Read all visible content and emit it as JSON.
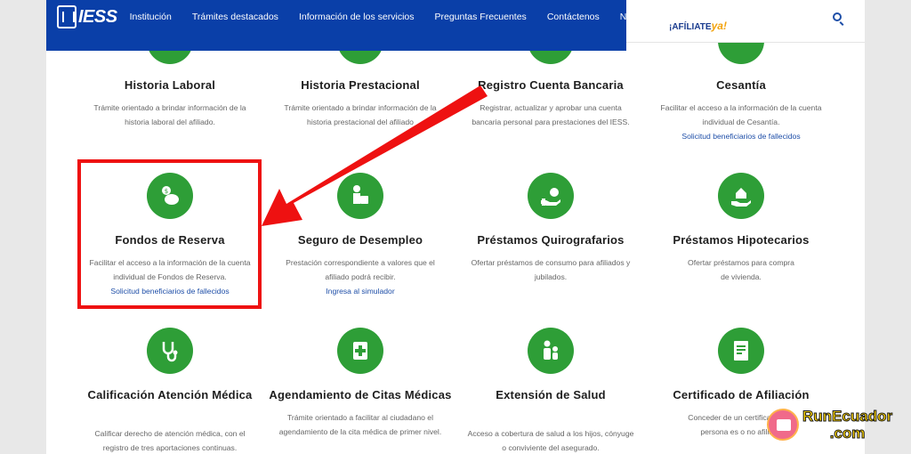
{
  "nav": {
    "logo": "IESS",
    "items": [
      "Institución",
      "Trámites destacados",
      "Información de los servicios",
      "Preguntas Frecuentes",
      "Contáctenos",
      "Noticias"
    ]
  },
  "header_right": {
    "afiliate_main": "¡AFÍLIATE",
    "afiliate_ya": "ya!"
  },
  "cards": [
    {
      "title": "Historia Laboral",
      "desc": [
        "Trámite orientado a brindar información de la",
        "historia laboral del afiliado."
      ],
      "link": ""
    },
    {
      "title": "Historia Prestacional",
      "desc": [
        "Trámite orientado a brindar información de la",
        "historia prestacional del afiliado"
      ],
      "link": ""
    },
    {
      "title": "Registro Cuenta Bancaria",
      "desc": [
        "Registrar, actualizar y aprobar una cuenta",
        "bancaria personal para prestaciones del IESS."
      ],
      "link": ""
    },
    {
      "title": "Cesantía",
      "desc": [
        "Facilitar el acceso a la información de la cuenta",
        "individual de Cesantía."
      ],
      "link": "Solicitud beneficiarios de fallecidos"
    },
    {
      "title": "Fondos de Reserva",
      "desc": [
        "Facilitar el acceso a la información de la cuenta",
        "individual de Fondos de Reserva."
      ],
      "link": "Solicitud beneficiarios de fallecidos"
    },
    {
      "title": "Seguro de Desempleo",
      "desc": [
        "Prestación correspondiente a valores que el",
        "afiliado podrá recibir."
      ],
      "link": "Ingresa al simulador"
    },
    {
      "title": "Préstamos Quirografarios",
      "desc": [
        "Ofertar préstamos de consumo para afiliados y",
        "jubilados."
      ],
      "link": ""
    },
    {
      "title": "Préstamos Hipotecarios",
      "desc": [
        "",
        "Ofertar préstamos para compra",
        "de vivienda."
      ],
      "link": ""
    },
    {
      "title": "Calificación Atención Médica",
      "desc": [
        "Calificar derecho de atención médica, con el",
        "registro de tres aportaciones continuas."
      ],
      "link": ""
    },
    {
      "title": "Agendamiento de Citas Médicas",
      "desc": [
        "Trámite orientado a facilitar al ciudadano el",
        "agendamiento de la cita médica de primer nivel."
      ],
      "link": ""
    },
    {
      "title": "Extensión de Salud",
      "desc": [
        "Acceso a cobertura de salud a los hijos, cónyuge",
        "o conviviente del asegurado."
      ],
      "link": ""
    },
    {
      "title": "Certificado de Afiliación",
      "desc": [
        "Conceder de un certificado que",
        "persona es o no afiliada"
      ],
      "link": ""
    }
  ],
  "watermark": {
    "line1": "RunEcuador",
    "line2": ".com"
  },
  "colors": {
    "nav": "#0a3fa8",
    "icon_green": "#2e9e37",
    "highlight": "#ee1111",
    "link": "#1f4fa8"
  }
}
